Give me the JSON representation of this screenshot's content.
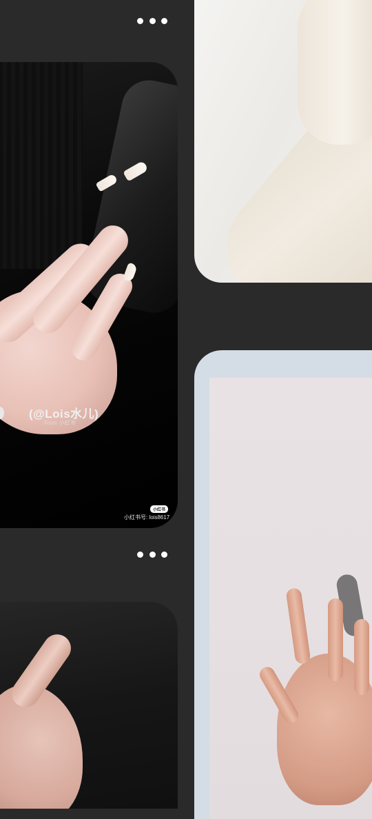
{
  "feed": {
    "left_column": [
      {
        "more_label": "More options",
        "image": {
          "alt": "",
          "watermark_handle": "(@Lois水儿)",
          "watermark_from": "From 小红书",
          "platform_tag": "小红书",
          "platform_id": "小红书号: lois8617"
        }
      },
      {
        "more_label": "More options",
        "image": {
          "alt": ""
        }
      }
    ],
    "right_column": [
      {
        "image": {
          "alt": ""
        }
      },
      {
        "image": {
          "alt": ""
        }
      }
    ]
  },
  "colors": {
    "background": "#2a2a2a",
    "dots": "#ffffff",
    "frame_blue": "#d4dde6"
  },
  "icons": {
    "more": "more-horizontal-icon"
  }
}
